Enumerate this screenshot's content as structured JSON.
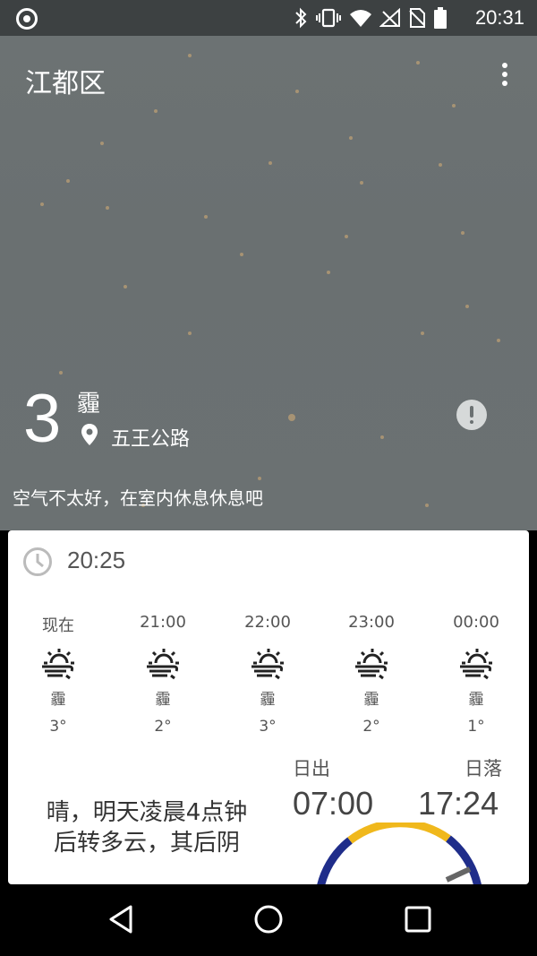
{
  "status_bar": {
    "time": "20:31"
  },
  "header": {
    "district": "江都区"
  },
  "aqi": {
    "value": "3",
    "level": "霾",
    "station": "五王公路",
    "advice": "空气不太好，在室内休息休息吧"
  },
  "card": {
    "update_time": "20:25",
    "hourly": [
      {
        "time": "现在",
        "condition": "霾",
        "temp": "3°"
      },
      {
        "time": "21:00",
        "condition": "霾",
        "temp": "2°"
      },
      {
        "time": "22:00",
        "condition": "霾",
        "temp": "3°"
      },
      {
        "time": "23:00",
        "condition": "霾",
        "temp": "2°"
      },
      {
        "time": "00:00",
        "condition": "霾",
        "temp": "1°"
      }
    ],
    "forecast_text": "晴，明天凌晨4点钟后转多云，其后阴",
    "sunrise_label": "日出",
    "sunrise_time": "07:00",
    "sunset_label": "日落",
    "sunset_time": "17:24"
  },
  "colors": {
    "hero_bg": "#6b7172",
    "arc_day": "#f0b81c",
    "arc_night": "#1f2d8a",
    "card_bg": "#ffffff"
  },
  "icons": [
    "hazy-sun-icon",
    "clock-icon",
    "location-pin-icon",
    "warning-icon",
    "overflow-menu-icon"
  ]
}
